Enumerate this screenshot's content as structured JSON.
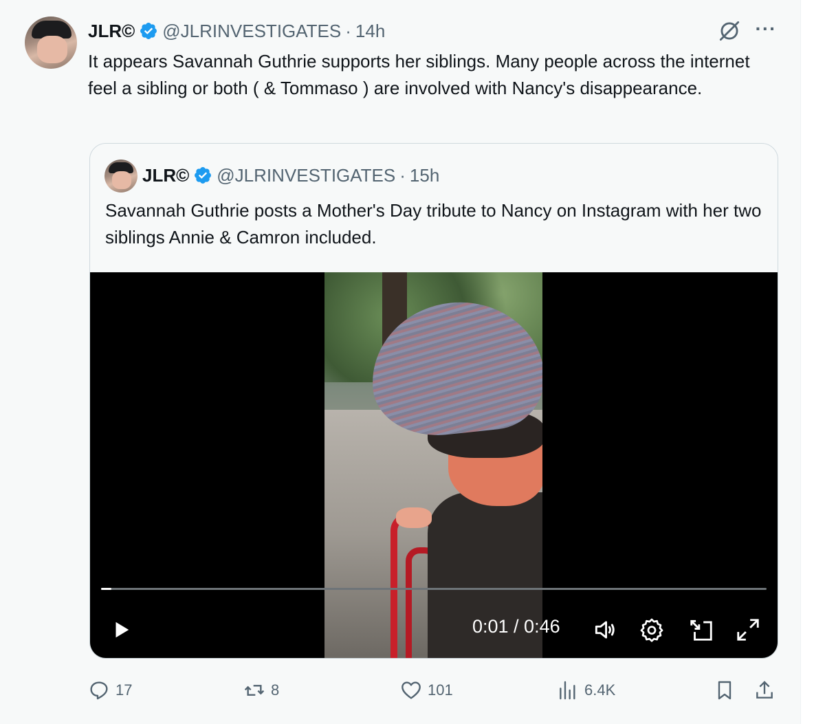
{
  "tweet": {
    "author_name": "JLR©",
    "handle": "@JLRINVESTIGATES",
    "separator": "·",
    "time": "14h",
    "text": "It appears Savannah Guthrie supports her siblings. Many people across the internet feel a sibling or both ( & Tommaso ) are involved with Nancy's disappearance."
  },
  "quoted_tweet": {
    "author_name": "JLR©",
    "handle": "@JLRINVESTIGATES",
    "separator": "·",
    "time": "15h",
    "text": "Savannah Guthrie posts a Mother's Day tribute to Nancy on Instagram with her two siblings Annie & Camron included.",
    "video": {
      "current_time": "0:01",
      "duration": "0:46",
      "time_display": "0:01 / 0:46",
      "progress_fraction": 0.015
    }
  },
  "actions": {
    "replies": "17",
    "reposts": "8",
    "likes": "101",
    "views": "6.4K"
  },
  "colors": {
    "verified_badge": "#1d9bf0",
    "secondary_text": "#536471",
    "primary_text": "#0f1419",
    "background": "#f7f9f9"
  },
  "icons": [
    "verified-badge-icon",
    "grok-icon",
    "more-icon",
    "play-icon",
    "volume-icon",
    "settings-icon",
    "picture-in-picture-icon",
    "fullscreen-icon",
    "reply-icon",
    "repost-icon",
    "like-icon",
    "views-icon",
    "bookmark-icon",
    "share-icon"
  ]
}
